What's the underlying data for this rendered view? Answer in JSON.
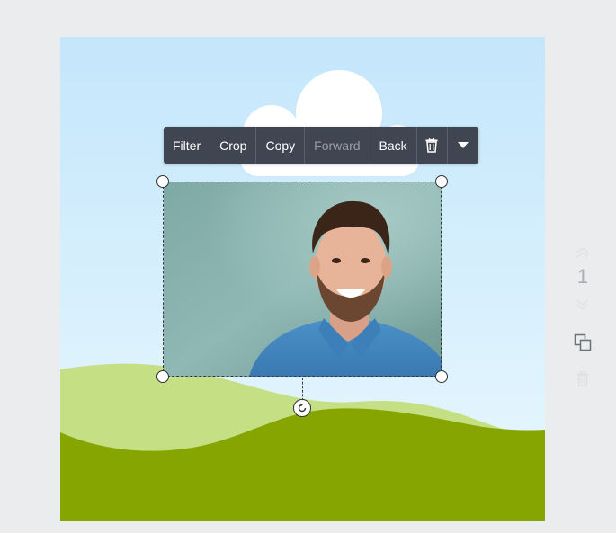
{
  "toolbar": {
    "filter_label": "Filter",
    "crop_label": "Crop",
    "copy_label": "Copy",
    "forward_label": "Forward",
    "back_label": "Back",
    "delete_icon": "trash-icon",
    "more_icon": "caret-down-icon"
  },
  "side_panel": {
    "page_number": "1",
    "up_icon": "chevron-up-icon",
    "down_icon": "chevron-down-icon",
    "duplicate_icon": "duplicate-icon",
    "delete_icon": "trash-icon"
  },
  "colors": {
    "workspace_bg": "#ebecee",
    "sky_top": "#c4e6fb",
    "hill_light": "#c5df84",
    "hill_dark": "#87a501",
    "cloud": "#ffffff",
    "toolbar_bg": "#404552",
    "toolbar_disabled_text": "#9a9ea8"
  }
}
